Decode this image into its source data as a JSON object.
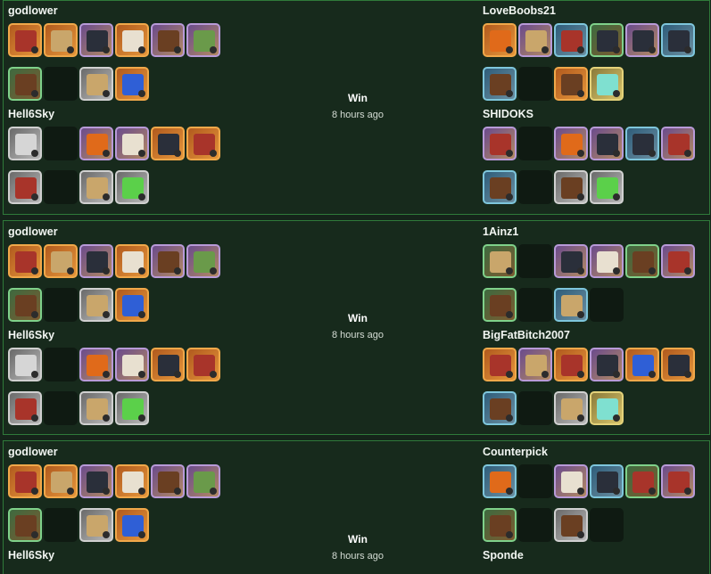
{
  "matches": [
    {
      "result": "Win",
      "time": "8 hours ago",
      "left_top": {
        "name": "godlower"
      },
      "left_bot": {
        "name": "Hell6Sky"
      },
      "right_top": {
        "name": "LoveBoobs21"
      },
      "right_bot": {
        "name": "SHIDOKS"
      }
    },
    {
      "result": "Win",
      "time": "8 hours ago",
      "left_top": {
        "name": "godlower"
      },
      "left_bot": {
        "name": "Hell6Sky"
      },
      "right_top": {
        "name": "1Ainz1"
      },
      "right_bot": {
        "name": "BigFatBitch2007"
      }
    },
    {
      "result": "Win",
      "time": "8 hours ago",
      "left_top": {
        "name": "godlower"
      },
      "left_bot": {
        "name": "Hell6Sky"
      },
      "right_top": {
        "name": "Counterpick"
      },
      "right_bot": {
        "name": "Sponde"
      }
    }
  ],
  "item_icons": {
    "weapon": "weapon-icon",
    "offhand": "offhand-icon",
    "helmet": "helmet-icon",
    "armor": "armor-icon",
    "boots": "boots-icon",
    "cape": "cape-icon",
    "bag": "bag-icon",
    "mount": "mount-icon",
    "potion": "potion-icon",
    "food": "food-icon"
  },
  "colors": {
    "background": "#15241a",
    "panel_border": "#2f7a3a",
    "tier_orange": "#f0a84a",
    "tier_purple": "#b89ad8",
    "tier_blue": "#7ec6dc",
    "tier_green": "#7fd18a"
  }
}
